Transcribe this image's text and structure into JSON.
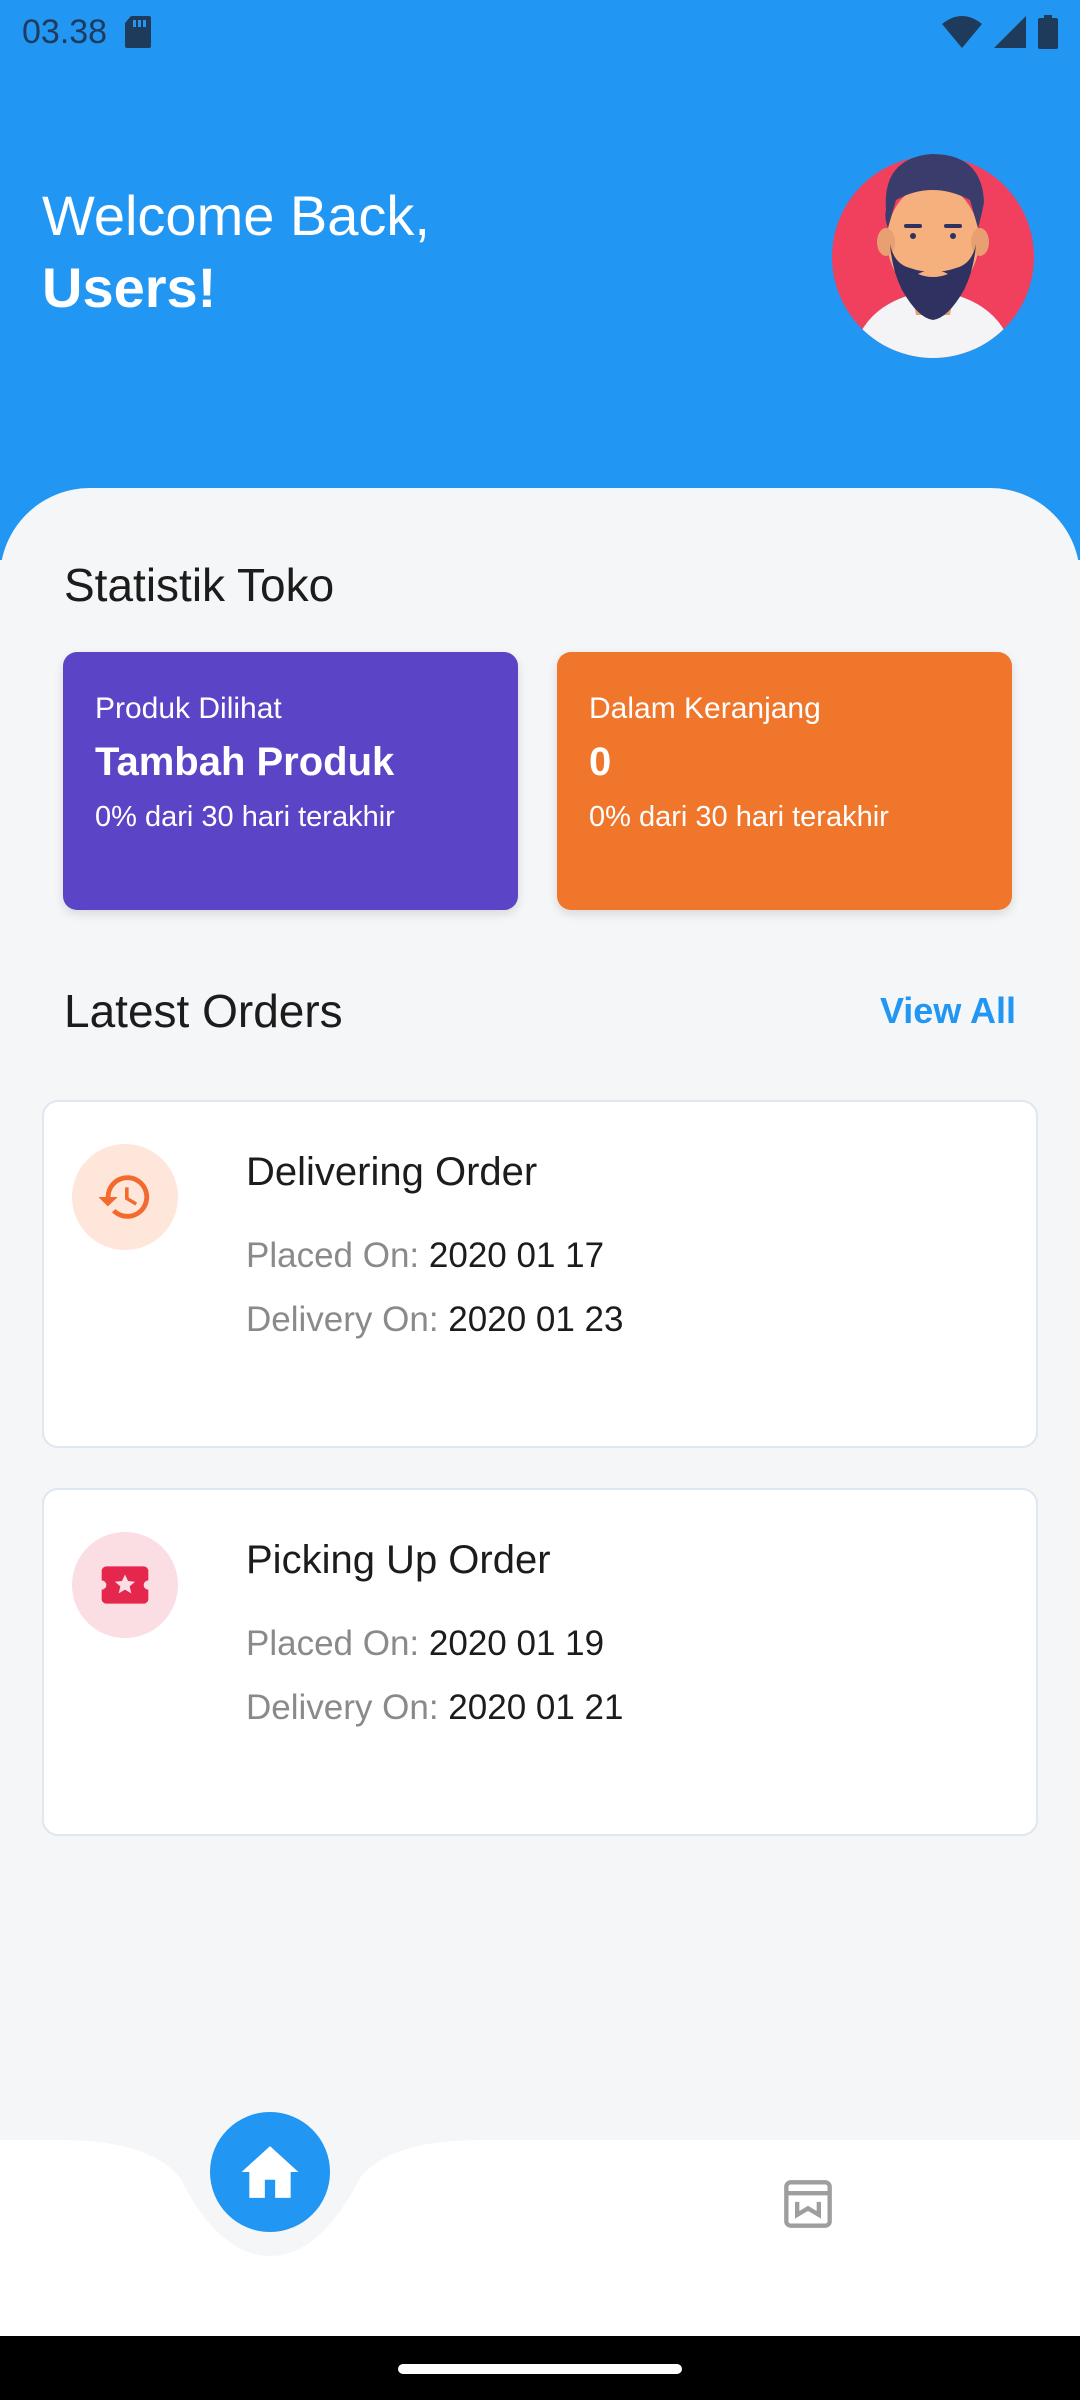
{
  "status_bar": {
    "time": "03.38"
  },
  "header": {
    "greeting": "Welcome Back,",
    "user": "Users!"
  },
  "stats": {
    "title": "Statistik Toko",
    "cards": [
      {
        "label": "Produk Dilihat",
        "value": "Tambah Produk",
        "sub": "0% dari 30 hari terakhir",
        "color": "#5b45c6"
      },
      {
        "label": "Dalam Keranjang",
        "value": "0",
        "sub": "0% dari 30 hari terakhir",
        "color": "#f0762c"
      }
    ]
  },
  "orders": {
    "title": "Latest Orders",
    "view_all": "View All",
    "items": [
      {
        "title": "Delivering Order",
        "placed_label": "Placed On:",
        "placed": "2020 01 17",
        "delivery_label": "Delivery On:",
        "delivery": "2020 01 23",
        "icon": "history-icon",
        "icon_bg": "#ffe6db",
        "icon_color": "#f26a2e"
      },
      {
        "title": "Picking Up Order",
        "placed_label": "Placed On:",
        "placed": "2020 01 19",
        "delivery_label": "Delivery On:",
        "delivery": "2020 01 21",
        "icon": "ticket-icon",
        "icon_bg": "#fbdde4",
        "icon_color": "#e5264d"
      }
    ]
  },
  "nav": {
    "items": [
      "home-icon",
      "store-icon"
    ]
  }
}
